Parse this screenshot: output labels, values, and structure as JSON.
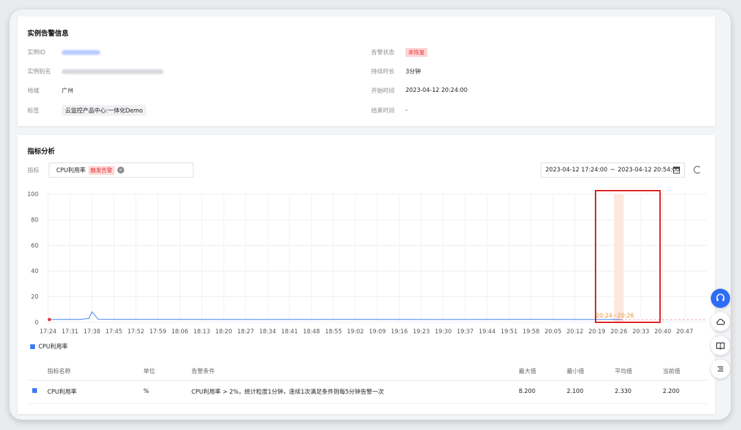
{
  "instance_card": {
    "title": "实例告警信息",
    "left": [
      {
        "label": "实例ID",
        "value": ""
      },
      {
        "label": "实例别名",
        "value": ""
      },
      {
        "label": "地域",
        "value": "广州"
      },
      {
        "label": "标签",
        "value": "云监控产品中心:一体化Demo"
      }
    ],
    "right": [
      {
        "label": "告警状态",
        "value": "未恢复"
      },
      {
        "label": "持续时长",
        "value": "3分钟"
      },
      {
        "label": "开始时间",
        "value": "2023-04-12 20:24:00"
      },
      {
        "label": "结束时间",
        "value": "-"
      }
    ]
  },
  "metric_card": {
    "title": "指标分析",
    "metric_label": "指标",
    "metric_name": "CPU利用率",
    "trigger_tag": "触发告警",
    "remove_glyph": "×",
    "date_start": "2023-04-12 17:24:00",
    "date_sep": "~",
    "date_end": "2023-04-12 20:54:00"
  },
  "colors": {
    "series": "#3d7bf6",
    "alarm_band": "#fde8de",
    "highlight_box": "#e01b1b",
    "threshold": "#f09ea0",
    "alarm_text": "#f2932d"
  },
  "chart_data": {
    "type": "line",
    "y_ticks": [
      0,
      20,
      40,
      60,
      80,
      100
    ],
    "ylim": [
      0,
      100
    ],
    "x_ticks": [
      "17:24",
      "17:31",
      "17:38",
      "17:45",
      "17:52",
      "17:59",
      "18:06",
      "18:13",
      "18:20",
      "18:27",
      "18:34",
      "18:41",
      "18:48",
      "18:55",
      "19:02",
      "19:09",
      "19:16",
      "19:23",
      "19:30",
      "19:37",
      "19:44",
      "19:51",
      "19:58",
      "20:05",
      "20:12",
      "20:19",
      "20:26",
      "20:33",
      "20:40",
      "20:47"
    ],
    "grid": true,
    "threshold": 2,
    "series": [
      {
        "name": "CPU利用率",
        "x": [
          "17:24",
          "17:30",
          "17:33",
          "17:35",
          "17:37",
          "17:38",
          "17:40",
          "17:45",
          "18:00",
          "18:30",
          "19:00",
          "19:30",
          "20:00",
          "20:15",
          "20:24",
          "20:27"
        ],
        "y": [
          2.2,
          2.3,
          2.2,
          2.5,
          3.0,
          8.2,
          2.4,
          2.3,
          2.3,
          2.2,
          2.3,
          2.2,
          2.3,
          2.2,
          2.3,
          2.2
        ]
      }
    ],
    "alarm_window": {
      "label": "20:24~20:26",
      "start": "20:24",
      "end": "20:26"
    },
    "legend": {
      "label": "CPU利用率",
      "position": "bottom-left"
    }
  },
  "stats_table": {
    "headers": [
      "指标名称",
      "单位",
      "告警条件",
      "最大值",
      "最小值",
      "平均值",
      "当前值"
    ],
    "rows": [
      {
        "name": "CPU利用率",
        "unit": "%",
        "condition": "CPU利用率 > 2%，统计粒度1分钟，连续1次满足条件则每5分钟告警一次",
        "max": "8.200",
        "min": "2.100",
        "avg": "2.330",
        "current": "2.200"
      }
    ]
  },
  "float_tools": [
    "headset-icon",
    "cloud-icon",
    "book-icon",
    "list-icon"
  ]
}
